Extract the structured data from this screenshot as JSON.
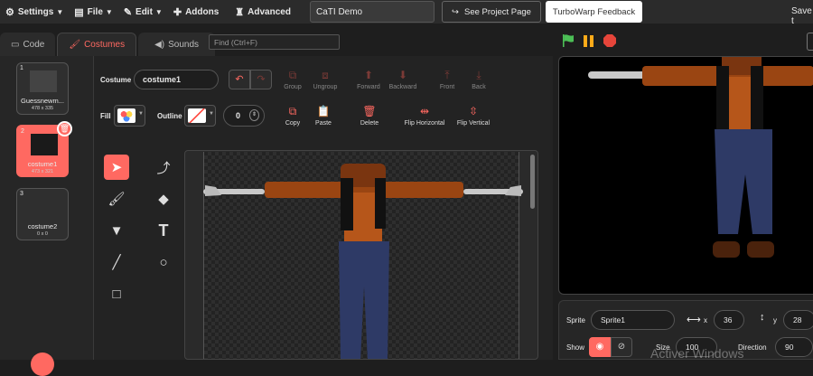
{
  "menubar": {
    "settings": "Settings",
    "file": "File",
    "edit": "Edit",
    "addons": "Addons",
    "advanced": "Advanced",
    "project_title": "CaTI Demo",
    "see_project_page": "See Project Page",
    "feedback": "TurboWarp Feedback",
    "save": "Save t"
  },
  "tabs": {
    "code": "Code",
    "costumes": "Costumes",
    "sounds": "Sounds"
  },
  "find": {
    "placeholder": "Find (Ctrl+F)"
  },
  "costumes": [
    {
      "num": "1",
      "name": "Guessnewm...",
      "size": "478 x 335",
      "selected": false
    },
    {
      "num": "2",
      "name": "costume1",
      "size": "473 x 321",
      "selected": true
    },
    {
      "num": "3",
      "name": "costume2",
      "size": "0 x 0",
      "selected": false
    }
  ],
  "editor": {
    "costume_label": "Costume",
    "costume_name": "costume1",
    "group": "Group",
    "ungroup": "Ungroup",
    "forward": "Forward",
    "backward": "Backward",
    "front": "Front",
    "back": "Back",
    "fill_label": "Fill",
    "outline_label": "Outline",
    "outline_width": "0",
    "copy": "Copy",
    "paste": "Paste",
    "delete": "Delete",
    "flip_horizontal": "Flip Horizontal",
    "flip_vertical": "Flip Vertical"
  },
  "sprite": {
    "sprite_label": "Sprite",
    "name": "Sprite1",
    "x_label": "x",
    "x": "36",
    "y_label": "y",
    "y": "28",
    "show_label": "Show",
    "size_label": "Size",
    "size": "100",
    "direction_label": "Direction",
    "direction": "90"
  },
  "watermark": "Activer Windows",
  "colors": {
    "accent": "#ff6961",
    "background": "#1e1e1e"
  }
}
